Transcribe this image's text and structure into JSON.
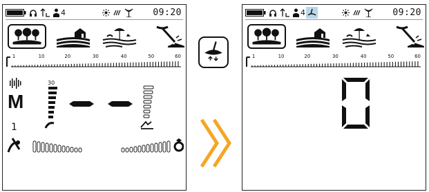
{
  "panels": [
    {
      "status": {
        "headphone_icon": "headphone-icon",
        "sensitivity_icon": "sensitivity-icon",
        "frequency_icon": "frequency-icon",
        "frequency_value": "4",
        "time": "09:20"
      },
      "modes": [
        "park",
        "field",
        "beach",
        "gold"
      ],
      "selected_mode": "park",
      "scale": {
        "labels": [
          "1",
          "10",
          "20",
          "30",
          "40",
          "50",
          "60"
        ]
      },
      "display": {
        "mode_letter": "M",
        "level_label": "30",
        "sub_value": "1"
      }
    },
    {
      "status": {
        "headphone_icon": "headphone-icon",
        "sensitivity_icon": "sensitivity-icon",
        "frequency_icon": "frequency-icon",
        "frequency_value": "4",
        "time": "09:20"
      },
      "modes": [
        "park",
        "field",
        "beach",
        "gold"
      ],
      "selected_mode": "park",
      "scale": {
        "labels": [
          "1",
          "10",
          "20",
          "30",
          "40",
          "50",
          "60"
        ]
      },
      "display": {
        "digit": "0"
      }
    }
  ],
  "colors": {
    "accent_orange": "#f5a623",
    "wire_highlight": "#b9d7e9",
    "ink": "#111111"
  }
}
